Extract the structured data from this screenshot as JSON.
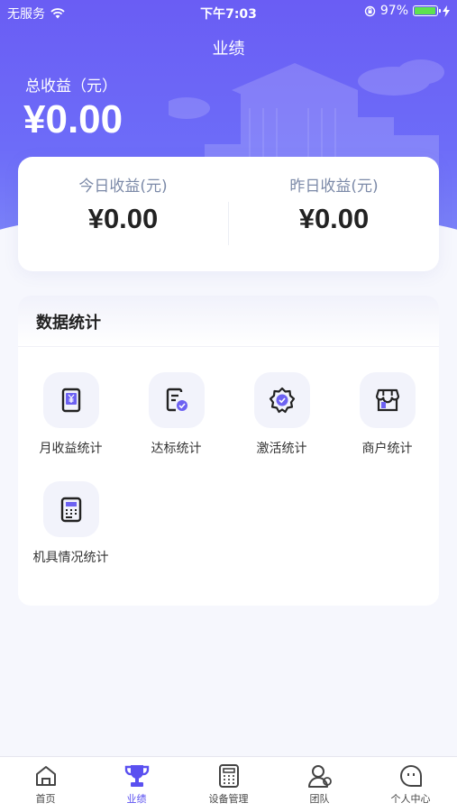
{
  "status_bar": {
    "carrier": "无服务",
    "time": "下午7:03",
    "battery": "97%"
  },
  "header": {
    "title": "业绩",
    "total_label": "总收益（元）",
    "total_value": "¥0.00"
  },
  "earnings": {
    "today_label": "今日收益(元)",
    "today_value": "¥0.00",
    "yesterday_label": "昨日收益(元)",
    "yesterday_value": "¥0.00"
  },
  "stats": {
    "title": "数据统计",
    "items": [
      {
        "label": "月收益统计",
        "icon": "monthly-income-icon"
      },
      {
        "label": "达标统计",
        "icon": "target-report-icon"
      },
      {
        "label": "激活统计",
        "icon": "activation-badge-icon"
      },
      {
        "label": "商户统计",
        "icon": "merchant-store-icon"
      },
      {
        "label": "机具情况统计",
        "icon": "terminal-device-icon"
      }
    ]
  },
  "tabbar": {
    "items": [
      {
        "label": "首页",
        "icon": "home-icon"
      },
      {
        "label": "业绩",
        "icon": "trophy-icon"
      },
      {
        "label": "设备管理",
        "icon": "calculator-device-icon"
      },
      {
        "label": "团队",
        "icon": "team-icon"
      },
      {
        "label": "个人中心",
        "icon": "profile-icon"
      }
    ],
    "active_index": 1
  },
  "colors": {
    "accent": "#5a50f0",
    "header": "#6a5df4",
    "icon_tint": "#6d62f2"
  }
}
